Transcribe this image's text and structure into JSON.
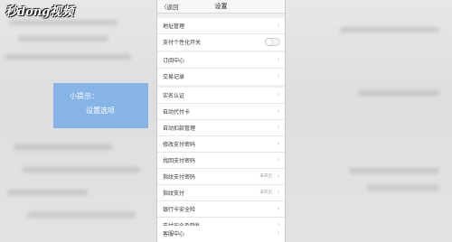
{
  "watermark": "秒dong视频",
  "tip": {
    "line1": "小提示：",
    "line2": "设置选项"
  },
  "nav": {
    "back_label": "〈返回",
    "title": "设置"
  },
  "groups": [
    {
      "items": [
        {
          "label": "地址管理"
        },
        {
          "label": "支付个性化开关",
          "toggle": true
        }
      ]
    },
    {
      "items": [
        {
          "label": "订阅中心"
        },
        {
          "label": "交易记录"
        }
      ]
    },
    {
      "items": [
        {
          "label": "实名认证"
        },
        {
          "label": "自动代付卡"
        },
        {
          "label": "自动扣款管理"
        },
        {
          "label": "修改支付密码"
        },
        {
          "label": "找回支付密码"
        },
        {
          "label": "指纹支付密码",
          "status": "未开启"
        },
        {
          "label": "指纹支付",
          "status": "未开启"
        },
        {
          "label": "银行卡安全险"
        },
        {
          "label": "支付安全及隐私"
        }
      ]
    },
    {
      "items": [
        {
          "label": "客服中心"
        }
      ]
    }
  ],
  "icons": {
    "chevron": "chevron-right-icon"
  }
}
